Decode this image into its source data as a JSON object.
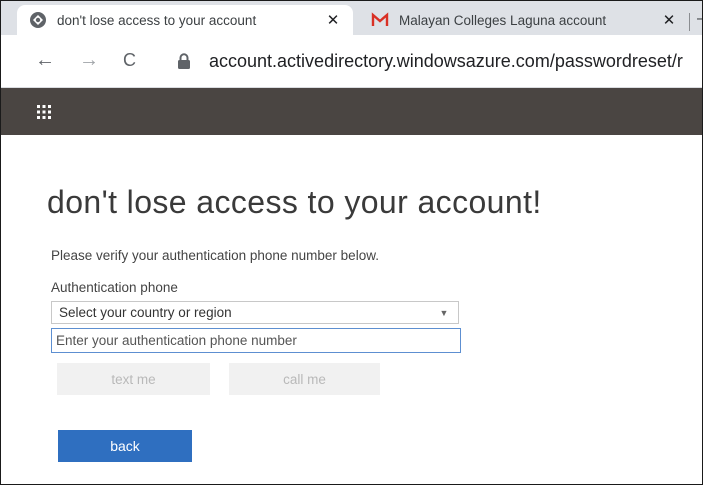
{
  "browser": {
    "tabs": [
      {
        "title": "don't lose access to your account",
        "favicon": "microsoft-globe-icon",
        "close": "✕"
      },
      {
        "title": "Malayan Colleges Laguna account",
        "favicon": "gmail-icon",
        "close": "✕"
      }
    ],
    "more_tabs_glyph": "–",
    "nav": {
      "back": "←",
      "forward": "→",
      "reload": "C"
    },
    "url": "account.activedirectory.windowsazure.com/passwordreset/r"
  },
  "appbar": {
    "launcher_icon": "app-launcher-waffle-icon",
    "color": "#4a4542"
  },
  "page": {
    "heading": "don't lose access to your account!",
    "instructions": "Please verify your authentication phone number below.",
    "phone_label": "Authentication phone",
    "country_select": {
      "value": "Select your country or region"
    },
    "phone_input": {
      "value": "",
      "placeholder": "Enter your authentication phone number"
    },
    "buttons": {
      "text_me": "text me",
      "call_me": "call me",
      "back": "back"
    }
  },
  "colors": {
    "accent": "#2f6fc0",
    "focus_border": "#5d8fd1",
    "disabled_bg": "#f1f1f1"
  }
}
